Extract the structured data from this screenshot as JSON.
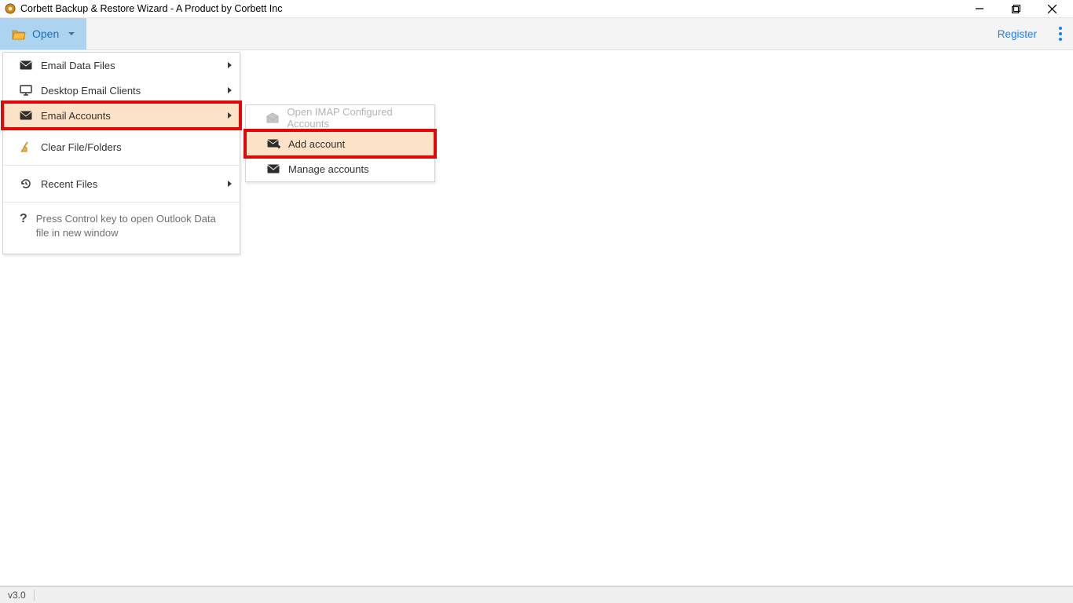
{
  "window": {
    "title": "Corbett Backup & Restore Wizard - A Product by Corbett Inc"
  },
  "toolbar": {
    "open_label": "Open",
    "register_label": "Register"
  },
  "menu": {
    "items": [
      {
        "label": "Email Data Files",
        "has_submenu": true
      },
      {
        "label": "Desktop Email Clients",
        "has_submenu": true
      },
      {
        "label": "Email Accounts",
        "has_submenu": true,
        "highlight": true
      },
      {
        "label": "Clear File/Folders"
      },
      {
        "label": "Recent Files",
        "has_submenu": true
      }
    ],
    "hint": "Press Control key to open Outlook Data file in new window"
  },
  "submenu": {
    "items": [
      {
        "label": "Open IMAP Configured Accounts",
        "disabled": true
      },
      {
        "label": "Add account",
        "highlight": true
      },
      {
        "label": "Manage accounts"
      }
    ]
  },
  "status": {
    "version": "v3.0"
  }
}
